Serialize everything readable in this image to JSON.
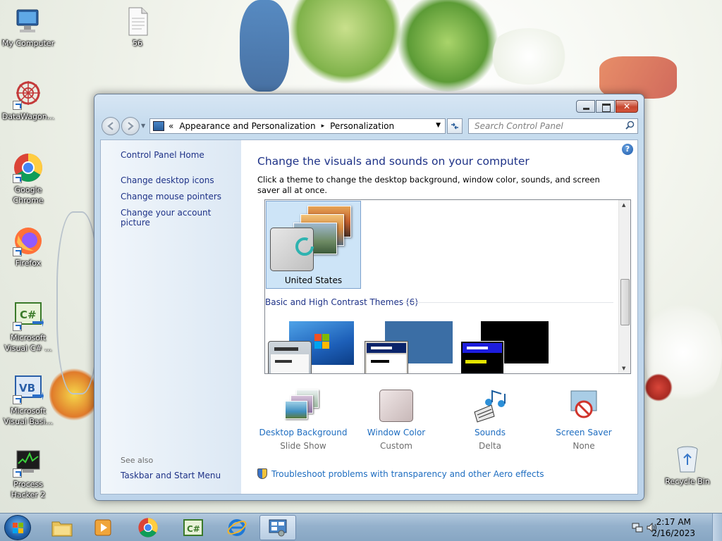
{
  "desktop": {
    "icons": [
      {
        "label": "My Computer"
      },
      {
        "label": "DataWagon..."
      },
      {
        "label": "Google Chrome"
      },
      {
        "label": "Firefox"
      },
      {
        "label": "Microsoft Visual C# ..."
      },
      {
        "label": "Microsoft Visual Basi..."
      },
      {
        "label": "Process Hacker 2"
      },
      {
        "label": "56"
      },
      {
        "label": "Recycle Bin"
      }
    ]
  },
  "window": {
    "close_symbol": "✕",
    "address": {
      "chevron": "«",
      "segments": [
        "Appearance and Personalization",
        "Personalization"
      ],
      "separator": "▸"
    },
    "search": {
      "placeholder": "Search Control Panel"
    },
    "left_pane": {
      "home": "Control Panel Home",
      "links": [
        "Change desktop icons",
        "Change mouse pointers",
        "Change your account picture"
      ],
      "see_also_label": "See also",
      "see_also_links": [
        "Taskbar and Start Menu"
      ]
    },
    "help_symbol": "?",
    "heading": "Change the visuals and sounds on your computer",
    "description": "Click a theme to change the desktop background, window color, sounds, and screen saver all at once.",
    "themes": {
      "selected": {
        "label": "United States"
      },
      "section_header": "Basic and High Contrast Themes (6)"
    },
    "settings": [
      {
        "label": "Desktop Background",
        "value": "Slide Show",
        "icon": "desktop-background-icon"
      },
      {
        "label": "Window Color",
        "value": "Custom",
        "icon": "window-color-icon"
      },
      {
        "label": "Sounds",
        "value": "Delta",
        "icon": "sounds-icon"
      },
      {
        "label": "Screen Saver",
        "value": "None",
        "icon": "screen-saver-icon"
      }
    ],
    "troubleshoot_link": "Troubleshoot problems with transparency and other Aero effects"
  },
  "taskbar": {
    "items": [
      "file-explorer-icon",
      "media-player-icon",
      "chrome-icon",
      "visual-csharp-icon",
      "internet-explorer-icon",
      "control-panel-icon"
    ],
    "clock": {
      "time": "2:17 AM",
      "date": "2/16/2023"
    }
  },
  "colors": {
    "link": "#1e3287",
    "accent_link": "#1e6dc0",
    "taskbar": "#94b1cc"
  }
}
